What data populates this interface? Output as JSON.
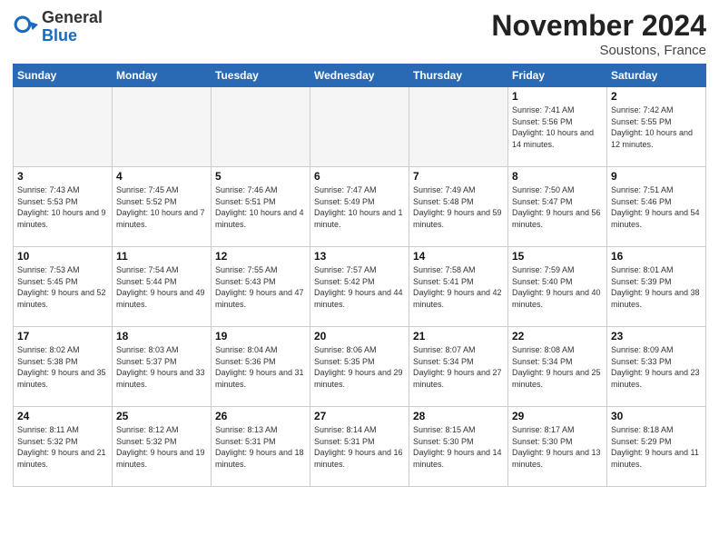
{
  "header": {
    "logo_general": "General",
    "logo_blue": "Blue",
    "month_title": "November 2024",
    "location": "Soustons, France"
  },
  "weekdays": [
    "Sunday",
    "Monday",
    "Tuesday",
    "Wednesday",
    "Thursday",
    "Friday",
    "Saturday"
  ],
  "weeks": [
    [
      {
        "day": "",
        "info": ""
      },
      {
        "day": "",
        "info": ""
      },
      {
        "day": "",
        "info": ""
      },
      {
        "day": "",
        "info": ""
      },
      {
        "day": "",
        "info": ""
      },
      {
        "day": "1",
        "info": "Sunrise: 7:41 AM\nSunset: 5:56 PM\nDaylight: 10 hours and 14 minutes."
      },
      {
        "day": "2",
        "info": "Sunrise: 7:42 AM\nSunset: 5:55 PM\nDaylight: 10 hours and 12 minutes."
      }
    ],
    [
      {
        "day": "3",
        "info": "Sunrise: 7:43 AM\nSunset: 5:53 PM\nDaylight: 10 hours and 9 minutes."
      },
      {
        "day": "4",
        "info": "Sunrise: 7:45 AM\nSunset: 5:52 PM\nDaylight: 10 hours and 7 minutes."
      },
      {
        "day": "5",
        "info": "Sunrise: 7:46 AM\nSunset: 5:51 PM\nDaylight: 10 hours and 4 minutes."
      },
      {
        "day": "6",
        "info": "Sunrise: 7:47 AM\nSunset: 5:49 PM\nDaylight: 10 hours and 1 minute."
      },
      {
        "day": "7",
        "info": "Sunrise: 7:49 AM\nSunset: 5:48 PM\nDaylight: 9 hours and 59 minutes."
      },
      {
        "day": "8",
        "info": "Sunrise: 7:50 AM\nSunset: 5:47 PM\nDaylight: 9 hours and 56 minutes."
      },
      {
        "day": "9",
        "info": "Sunrise: 7:51 AM\nSunset: 5:46 PM\nDaylight: 9 hours and 54 minutes."
      }
    ],
    [
      {
        "day": "10",
        "info": "Sunrise: 7:53 AM\nSunset: 5:45 PM\nDaylight: 9 hours and 52 minutes."
      },
      {
        "day": "11",
        "info": "Sunrise: 7:54 AM\nSunset: 5:44 PM\nDaylight: 9 hours and 49 minutes."
      },
      {
        "day": "12",
        "info": "Sunrise: 7:55 AM\nSunset: 5:43 PM\nDaylight: 9 hours and 47 minutes."
      },
      {
        "day": "13",
        "info": "Sunrise: 7:57 AM\nSunset: 5:42 PM\nDaylight: 9 hours and 44 minutes."
      },
      {
        "day": "14",
        "info": "Sunrise: 7:58 AM\nSunset: 5:41 PM\nDaylight: 9 hours and 42 minutes."
      },
      {
        "day": "15",
        "info": "Sunrise: 7:59 AM\nSunset: 5:40 PM\nDaylight: 9 hours and 40 minutes."
      },
      {
        "day": "16",
        "info": "Sunrise: 8:01 AM\nSunset: 5:39 PM\nDaylight: 9 hours and 38 minutes."
      }
    ],
    [
      {
        "day": "17",
        "info": "Sunrise: 8:02 AM\nSunset: 5:38 PM\nDaylight: 9 hours and 35 minutes."
      },
      {
        "day": "18",
        "info": "Sunrise: 8:03 AM\nSunset: 5:37 PM\nDaylight: 9 hours and 33 minutes."
      },
      {
        "day": "19",
        "info": "Sunrise: 8:04 AM\nSunset: 5:36 PM\nDaylight: 9 hours and 31 minutes."
      },
      {
        "day": "20",
        "info": "Sunrise: 8:06 AM\nSunset: 5:35 PM\nDaylight: 9 hours and 29 minutes."
      },
      {
        "day": "21",
        "info": "Sunrise: 8:07 AM\nSunset: 5:34 PM\nDaylight: 9 hours and 27 minutes."
      },
      {
        "day": "22",
        "info": "Sunrise: 8:08 AM\nSunset: 5:34 PM\nDaylight: 9 hours and 25 minutes."
      },
      {
        "day": "23",
        "info": "Sunrise: 8:09 AM\nSunset: 5:33 PM\nDaylight: 9 hours and 23 minutes."
      }
    ],
    [
      {
        "day": "24",
        "info": "Sunrise: 8:11 AM\nSunset: 5:32 PM\nDaylight: 9 hours and 21 minutes."
      },
      {
        "day": "25",
        "info": "Sunrise: 8:12 AM\nSunset: 5:32 PM\nDaylight: 9 hours and 19 minutes."
      },
      {
        "day": "26",
        "info": "Sunrise: 8:13 AM\nSunset: 5:31 PM\nDaylight: 9 hours and 18 minutes."
      },
      {
        "day": "27",
        "info": "Sunrise: 8:14 AM\nSunset: 5:31 PM\nDaylight: 9 hours and 16 minutes."
      },
      {
        "day": "28",
        "info": "Sunrise: 8:15 AM\nSunset: 5:30 PM\nDaylight: 9 hours and 14 minutes."
      },
      {
        "day": "29",
        "info": "Sunrise: 8:17 AM\nSunset: 5:30 PM\nDaylight: 9 hours and 13 minutes."
      },
      {
        "day": "30",
        "info": "Sunrise: 8:18 AM\nSunset: 5:29 PM\nDaylight: 9 hours and 11 minutes."
      }
    ]
  ]
}
